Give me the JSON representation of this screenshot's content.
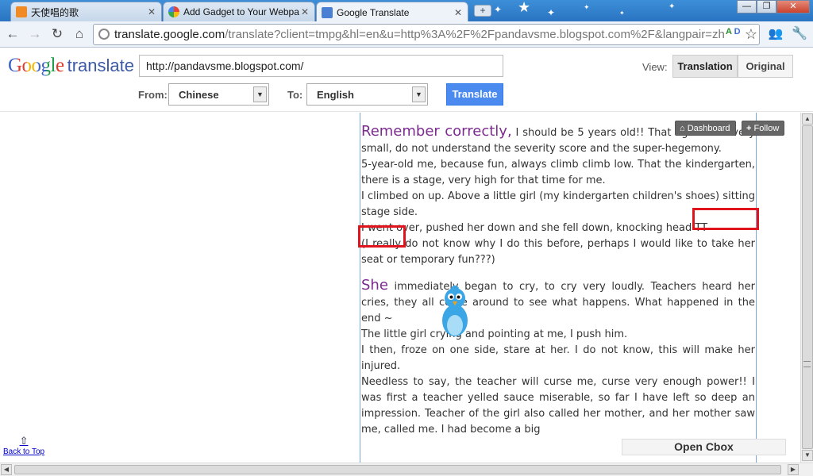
{
  "browser": {
    "tabs": [
      {
        "title": "天使唱的歌",
        "active": false,
        "favicon": "blogger-icon"
      },
      {
        "title": "Add Gadget to Your Webpa",
        "active": false,
        "favicon": "google-icon"
      },
      {
        "title": "Google Translate",
        "active": true,
        "favicon": "translate-icon"
      }
    ],
    "new_tab": "+",
    "url_host": "translate.google.com",
    "url_path": "/translate?client=tmpg&hl=en&u=http%3A%2F%2Fpandavsme.blogspot.com%2F&langpair=zh",
    "window_controls": {
      "minimize": "—",
      "restore": "❐",
      "close": "✕"
    }
  },
  "translate": {
    "logo_google": "Google",
    "logo_translate": "translate",
    "url_value": "http://pandavsme.blogspot.com/",
    "from_label": "From:",
    "from_value": "Chinese",
    "to_label": "To:",
    "to_value": "English",
    "translate_button": "Translate",
    "view_label": "View:",
    "view_translation": "Translation",
    "view_original": "Original"
  },
  "blogger_bar": {
    "dashboard": "Dashboard",
    "follow": "Follow"
  },
  "article": {
    "p1_head": "Remember correctly,",
    "p1": " I should be 5 years old!! That age is still very small, do not understand the severity score and the super-hegemony.",
    "p2": "5-year-old me, because fun, always climb climb low. That the kindergarten, there is a stage, very high for that time for me.",
    "p3": "I climbed on up. Above a little girl (my kindergarten children's shoes) sitting stage side.",
    "p4": "I went over, pushed her down and she fell down, knocking head TT",
    "p5": "(I really do not know why I do this before, perhaps I would like to take her seat or temporary fun???)",
    "p6_head": "She",
    "p6": " immediately began to cry, to cry very loudly. Teachers heard her cries, they all come around to see what happens. What happened in the end ~",
    "p7": "The little girl crying and pointing at me, I push him.",
    "p8": "I then, froze on one side, stare at her. I do not know, this will make her injured.",
    "p9": "Needless to say, the teacher will curse me, curse very enough power!! I was first a teacher yelled sauce miserable, so far I have left so deep an impression. Teacher of the girl also called her mother, and her mother saw me, called me. I had become a big"
  },
  "back_to_top": "Back to Top",
  "cbox_label": "Open Cbox",
  "colors": {
    "accent": "#4b8bf0",
    "title_purple": "#7b2a8e",
    "annotation_red": "#e0141c"
  }
}
